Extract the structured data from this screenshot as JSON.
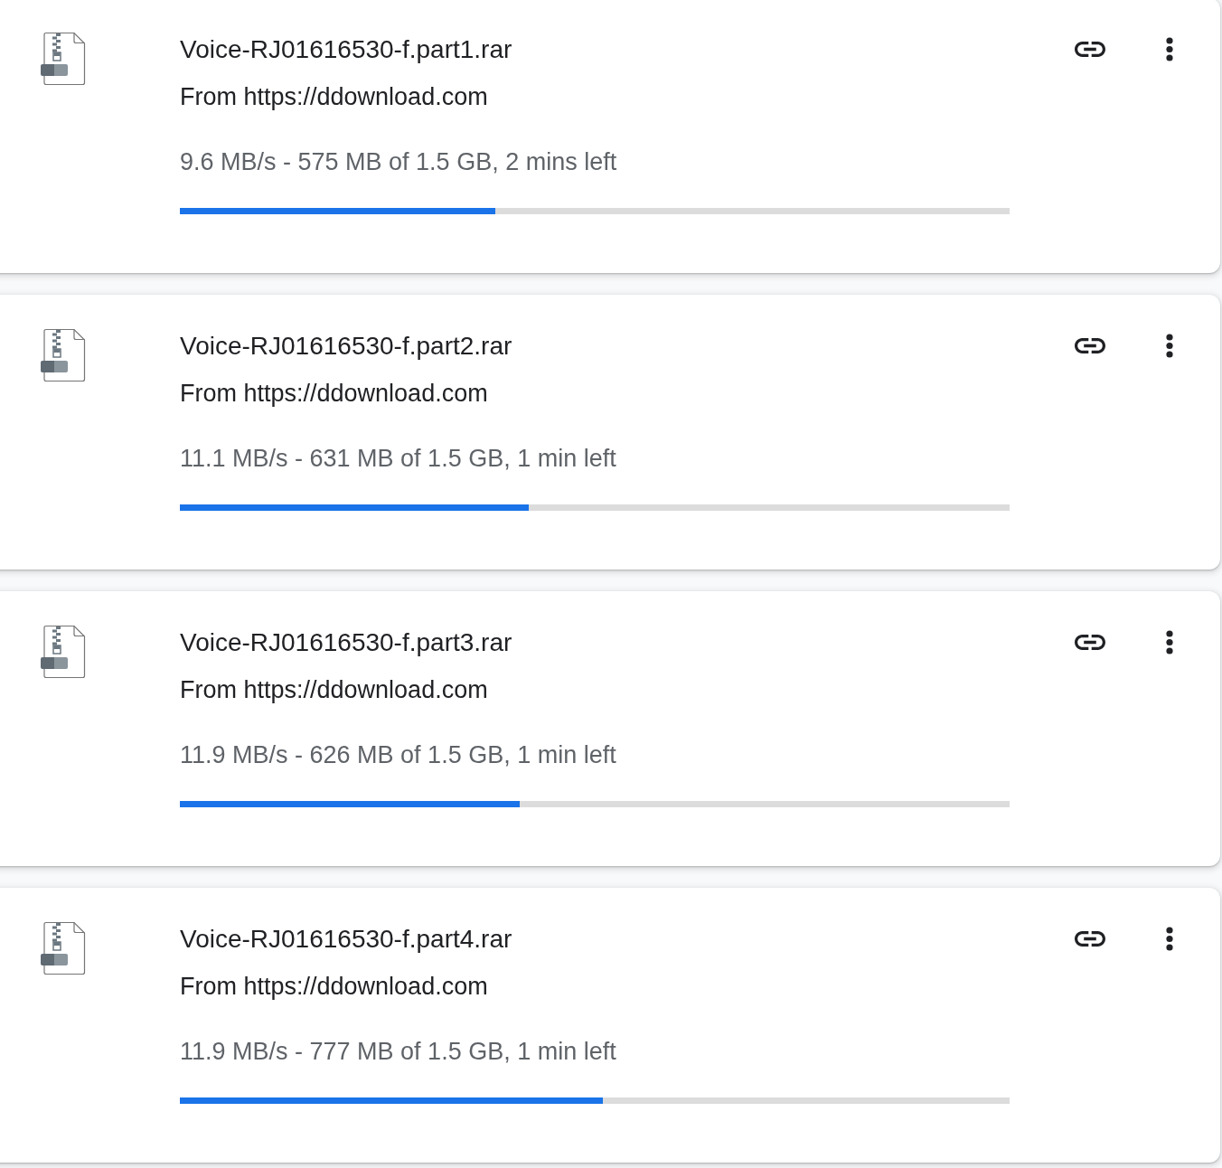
{
  "downloads": [
    {
      "file_name": "Voice-RJ01616530-f.part1.rar",
      "source": "From https://ddownload.com",
      "status": "9.6 MB/s - 575 MB of 1.5 GB, 2 mins left",
      "level": 0.38
    },
    {
      "file_name": "Voice-RJ01616530-f.part2.rar",
      "source": "From https://ddownload.com",
      "status": "11.1 MB/s - 631 MB of 1.5 GB, 1 min left",
      "level": 0.42
    },
    {
      "file_name": "Voice-RJ01616530-f.part3.rar",
      "source": "From https://ddownload.com",
      "status": "11.9 MB/s - 626 MB of 1.5 GB, 1 min left",
      "level": 0.41
    },
    {
      "file_name": "Voice-RJ01616530-f.part4.rar",
      "source": "From https://ddownload.com",
      "status": "11.9 MB/s - 777 MB of 1.5 GB, 1 min left",
      "level": 0.51
    }
  ]
}
